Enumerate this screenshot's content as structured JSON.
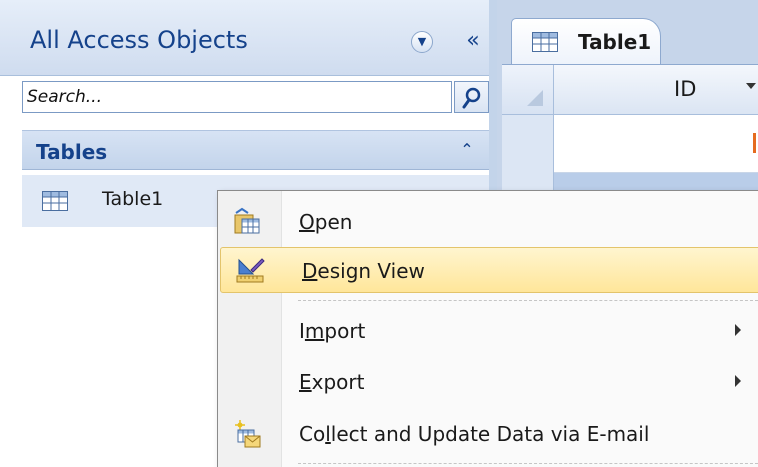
{
  "nav_pane": {
    "title": "All Access Objects",
    "search": {
      "placeholder": "Search..."
    },
    "groups": [
      {
        "label": "Tables",
        "items": [
          {
            "label": "Table1"
          }
        ]
      }
    ]
  },
  "document": {
    "tab_label": "Table1",
    "column_header": "ID"
  },
  "context_menu": {
    "items": [
      {
        "label_pre": "",
        "mnemonic": "O",
        "label_post": "pen",
        "icon": "open-table-icon"
      },
      {
        "label_pre": "",
        "mnemonic": "D",
        "label_post": "esign View",
        "icon": "design-view-icon",
        "highlighted": true
      },
      {
        "label_pre": "I",
        "mnemonic": "m",
        "label_post": "port",
        "has_submenu": true
      },
      {
        "label_pre": "",
        "mnemonic": "E",
        "label_post": "xport",
        "has_submenu": true
      },
      {
        "label_pre": "Co",
        "mnemonic": "l",
        "label_post": "lect and Update Data via E-mail",
        "icon": "collect-data-email-icon"
      }
    ]
  },
  "colors": {
    "accent_text": "#15428b",
    "highlight": "#ffe69a",
    "nav_selected": "#e0e9f6"
  }
}
